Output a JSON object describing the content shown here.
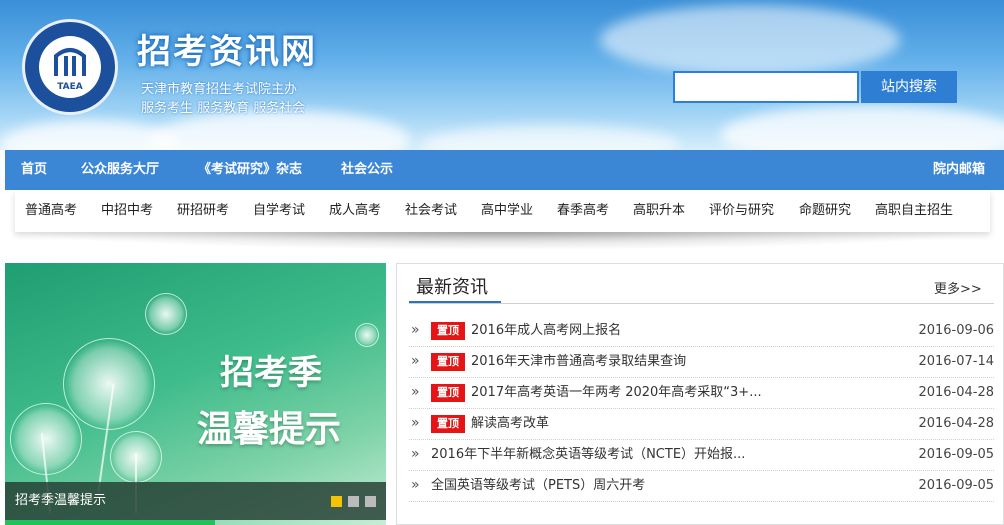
{
  "header": {
    "logo_text": "TAEA",
    "site_title": "招考资讯网",
    "subtitle_1": "天津市教育招生考试院主办",
    "subtitle_2": "服务考生 服务教育 服务社会",
    "search_placeholder": "",
    "search_button": "站内搜索"
  },
  "nav": {
    "items": [
      "首页",
      "公众服务大厅",
      "《考试研究》杂志",
      "社会公示"
    ],
    "mailbox": "院内邮箱"
  },
  "subnav": {
    "items": [
      "普通高考",
      "中招中考",
      "研招研考",
      "自学考试",
      "成人高考",
      "社会考试",
      "高中学业",
      "春季高考",
      "高职升本",
      "评价与研究",
      "命题研究",
      "高职自主招生"
    ]
  },
  "slideshow": {
    "title_line_1": "招考季",
    "title_line_2": "温馨提示",
    "caption": "招考季温馨提示",
    "slide_count": 3,
    "active_index": 0,
    "progress": 0.55
  },
  "news": {
    "title": "最新资讯",
    "more_label": "更多>>",
    "badge_label": "置顶",
    "rows": [
      {
        "pinned": true,
        "text": "2016年成人高考网上报名",
        "date": "2016-09-06"
      },
      {
        "pinned": true,
        "text": "2016年天津市普通高考录取结果查询",
        "date": "2016-07-14"
      },
      {
        "pinned": true,
        "text": "2017年高考英语一年两考 2020年高考采取“3+...",
        "date": "2016-04-28"
      },
      {
        "pinned": true,
        "text": "解读高考改革",
        "date": "2016-04-28"
      },
      {
        "pinned": false,
        "text": "2016年下半年新概念英语等级考试（NCTE）开始报...",
        "date": "2016-09-05"
      },
      {
        "pinned": false,
        "text": "全国英语等级考试（PETS）周六开考",
        "date": "2016-09-05"
      }
    ]
  },
  "colors": {
    "nav_bg": "#3b87d6",
    "accent_blue": "#2e7fd3",
    "badge_red": "#e51515",
    "slide_green": "#3fbc8b",
    "active_dot": "#f5c400"
  }
}
